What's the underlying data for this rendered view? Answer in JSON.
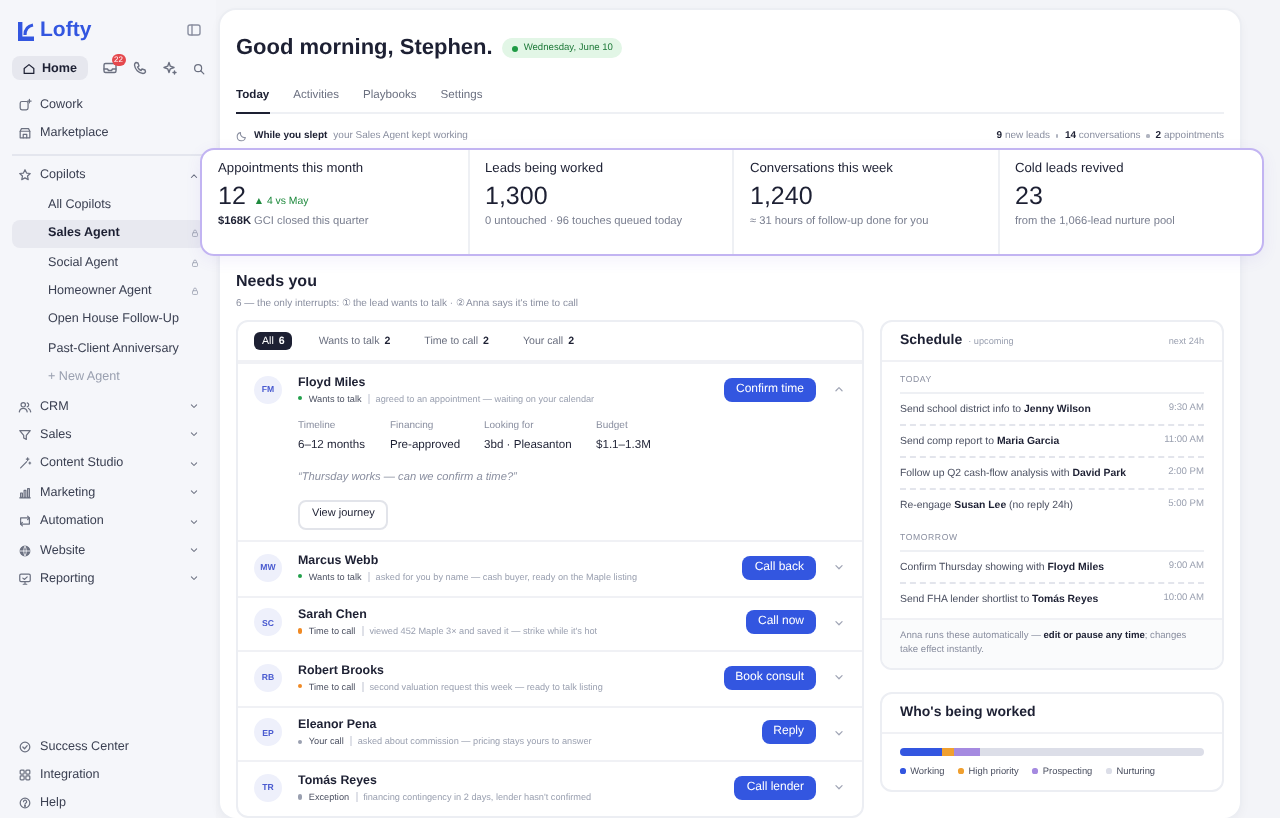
{
  "sidebar": {
    "brand": "Lofty",
    "home": {
      "label": "Home",
      "selected": true
    },
    "inbox_badge": "22",
    "top_items": [
      {
        "label": "Cowork"
      },
      {
        "label": "Marketplace"
      }
    ],
    "copilots": {
      "label": "Copilots",
      "expanded": true,
      "children": [
        {
          "label": "All Copilots",
          "selected": false,
          "locked": false
        },
        {
          "label": "Sales Agent",
          "selected": true,
          "locked": true
        },
        {
          "label": "Social Agent",
          "selected": false,
          "locked": true
        },
        {
          "label": "Homeowner Agent",
          "selected": false,
          "locked": true
        },
        {
          "label": "Open House Follow-Up",
          "selected": false,
          "locked": false
        },
        {
          "label": "Past-Client Anniversary",
          "selected": false,
          "locked": false
        }
      ],
      "new_agent": "+ New Agent"
    },
    "sections": [
      {
        "label": "CRM",
        "expanded": false
      },
      {
        "label": "Sales",
        "expanded": false
      },
      {
        "label": "Content Studio",
        "expanded": false
      },
      {
        "label": "Marketing",
        "expanded": false
      },
      {
        "label": "Automation",
        "expanded": false
      },
      {
        "label": "Website",
        "expanded": false
      },
      {
        "label": "Reporting",
        "expanded": false
      }
    ],
    "bottom": [
      {
        "label": "Success Center"
      },
      {
        "label": "Integration"
      },
      {
        "label": "Help"
      }
    ]
  },
  "header": {
    "greeting": "Good morning, Stephen.",
    "date": "Wednesday, June 10",
    "tabs": [
      {
        "label": "Today",
        "selected": true
      },
      {
        "label": "Activities",
        "selected": false
      },
      {
        "label": "Playbooks",
        "selected": false
      },
      {
        "label": "Settings",
        "selected": false
      }
    ],
    "summary": {
      "label": "While you slept",
      "note": "your Sales Agent kept working",
      "counts": [
        "**9** new leads",
        "**14** conversations",
        "**2** appointments"
      ]
    }
  },
  "stats": [
    {
      "label": "Appointments this month",
      "value": "12",
      "delta": "▲ 4 vs May",
      "note": "**$168K** GCI closed this quarter"
    },
    {
      "label": "Leads being worked",
      "value": "1,300",
      "note": "0 untouched · 96 touches queued today"
    },
    {
      "label": "Conversations this week",
      "value": "1,240",
      "note": "≈ 31 hours of follow-up done for you"
    },
    {
      "label": "Cold leads revived",
      "value": "23",
      "note": "from the 1,066-lead nurture pool"
    }
  ],
  "needs": {
    "title": "Needs you",
    "subtitle": "6 — the only interrupts: ① the lead wants to talk · ② Anna says it's time to call",
    "filters": [
      {
        "label": "All",
        "count": "6",
        "selected": true
      },
      {
        "label": "Wants to talk",
        "count": "2",
        "selected": false
      },
      {
        "label": "Time to call",
        "count": "2",
        "selected": false
      },
      {
        "label": "Your call",
        "count": "2",
        "selected": false
      }
    ],
    "leads": [
      {
        "initials": "FM",
        "name": "Floyd Miles",
        "status": "Wants to talk",
        "color": "#22a04b",
        "note": "agreed to an appointment — waiting on your calendar",
        "action": "Confirm time",
        "expanded": true,
        "details": [
          {
            "label": "Timeline",
            "value": "6–12 months"
          },
          {
            "label": "Financing",
            "value": "Pre-approved"
          },
          {
            "label": "Looking for",
            "value": "3bd · Pleasanton"
          },
          {
            "label": "Budget",
            "value": "$1.1–1.3M"
          }
        ],
        "quote": "“Thursday works — can we confirm a time?”",
        "secondary": "View journey"
      },
      {
        "initials": "MW",
        "name": "Marcus Webb",
        "status": "Wants to talk",
        "color": "#22a04b",
        "note": "asked for you by name — cash buyer, ready on the Maple listing",
        "action": "Call back",
        "expanded": false
      },
      {
        "initials": "SC",
        "name": "Sarah Chen",
        "status": "Time to call",
        "color": "#f08a24",
        "note": "viewed 452 Maple 3× and saved it — strike while it's hot",
        "action": "Call now",
        "expanded": false
      },
      {
        "initials": "RB",
        "name": "Robert Brooks",
        "status": "Time to call",
        "color": "#f08a24",
        "note": "second valuation request this week — ready to talk listing",
        "action": "Book consult",
        "expanded": false
      },
      {
        "initials": "EP",
        "name": "Eleanor Pena",
        "status": "Your call",
        "color": "#9aa0b0",
        "note": "asked about commission — pricing stays yours to answer",
        "action": "Reply",
        "expanded": false
      },
      {
        "initials": "TR",
        "name": "Tomás Reyes",
        "status": "Exception",
        "color": "#9aa0b0",
        "note": "financing contingency in 2 days, lender hasn't confirmed",
        "action": "Call lender",
        "expanded": false
      }
    ]
  },
  "schedule": {
    "title": "Schedule",
    "subtitle": "· upcoming",
    "range": "next 24h",
    "groups": [
      {
        "label": "TODAY",
        "items": [
          {
            "text": "Send school district info to **Jenny Wilson**",
            "time": "9:30 AM"
          },
          {
            "text": "Send comp report to **Maria Garcia**",
            "time": "11:00 AM"
          },
          {
            "text": "Follow up Q2 cash-flow analysis with **David Park**",
            "time": "2:00 PM"
          },
          {
            "text": "Re-engage **Susan Lee** (no reply 24h)",
            "time": "5:00 PM"
          }
        ]
      },
      {
        "label": "TOMORROW",
        "items": [
          {
            "text": "Confirm Thursday showing with **Floyd Miles**",
            "time": "9:00 AM"
          },
          {
            "text": "Send FHA lender shortlist to **Tomás Reyes**",
            "time": "10:00 AM"
          }
        ]
      }
    ],
    "footer": "Anna runs these automatically — **edit or pause any time**; changes take effect instantly."
  },
  "worked": {
    "title": "Who's being worked",
    "segments": [
      {
        "label": "Working",
        "color": "#3356e0"
      },
      {
        "label": "High priority",
        "color": "#f0a030"
      },
      {
        "label": "Prospecting",
        "color": "#a58ae0"
      },
      {
        "label": "Nurturing",
        "color": "#dcdee8"
      }
    ]
  }
}
